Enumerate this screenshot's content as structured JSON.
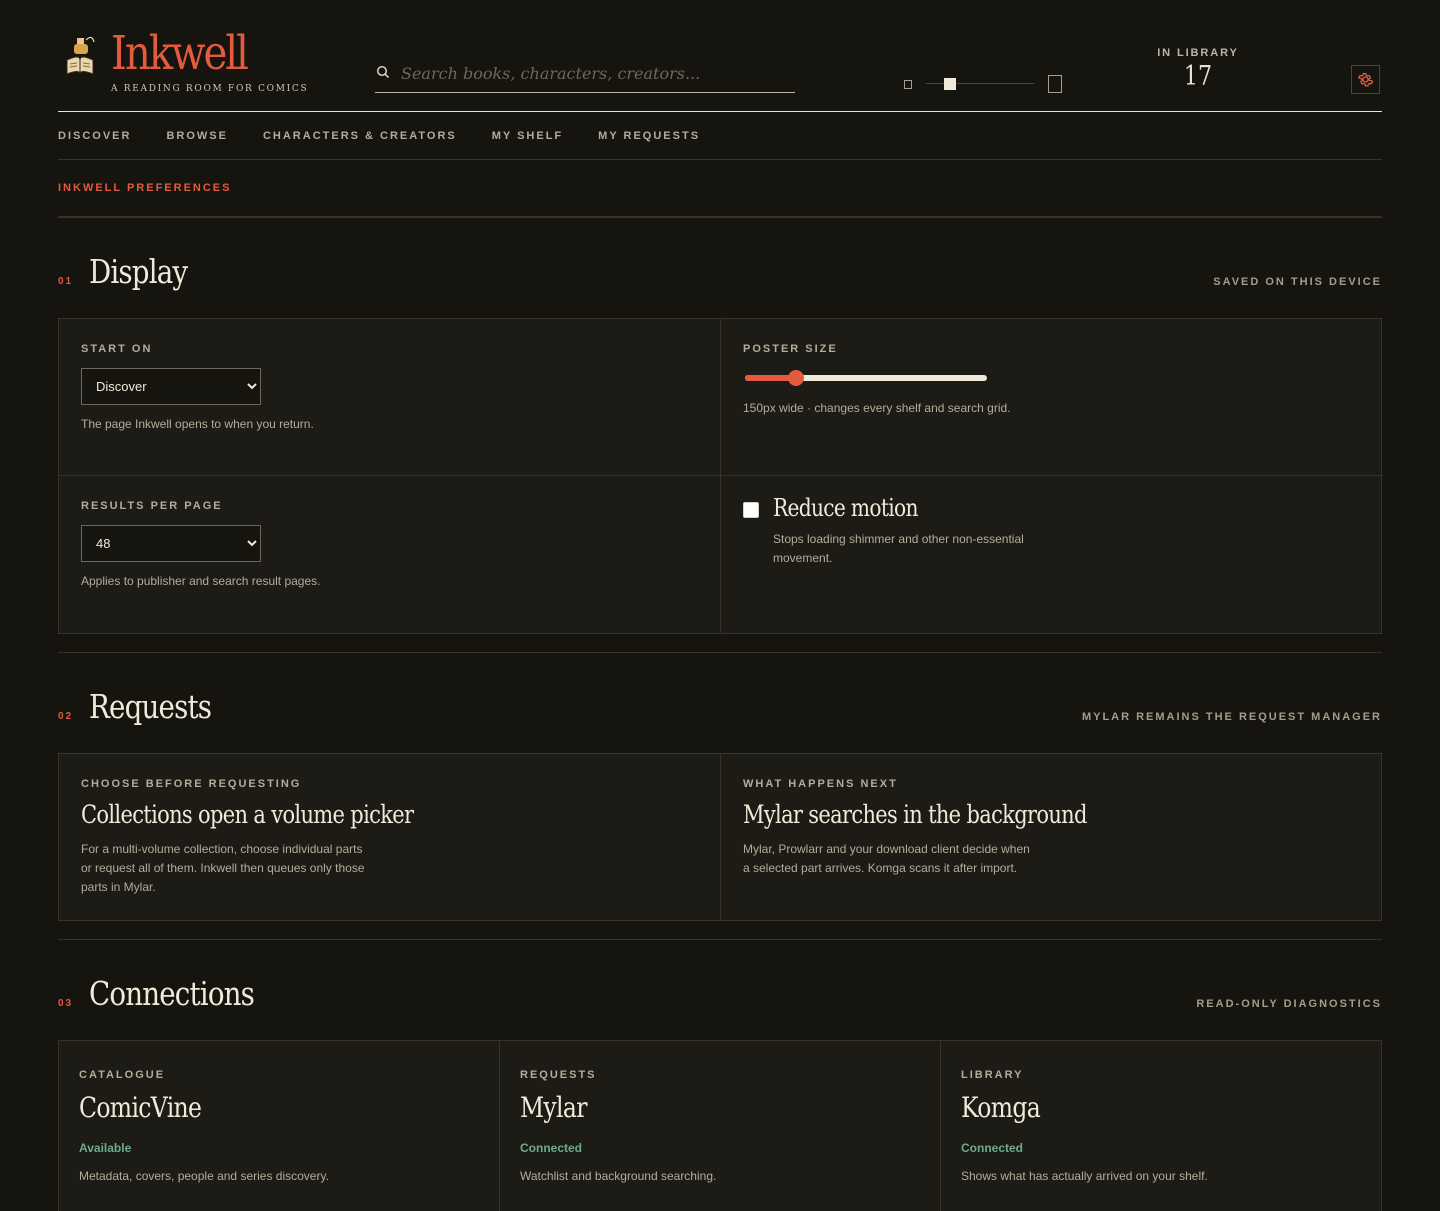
{
  "brand": {
    "name": "Inkwell",
    "tagline": "A READING ROOM FOR COMICS"
  },
  "search": {
    "placeholder": "Search books, characters, creators..."
  },
  "library": {
    "label": "IN LIBRARY",
    "count": "17"
  },
  "icons": {
    "logo": "inkwell-reading-icon",
    "search": "search-icon",
    "settings": "gear-icon"
  },
  "colors": {
    "accent": "#e35a3f",
    "background": "#16140f",
    "status_ok": "#6dab8c"
  },
  "nav": [
    "DISCOVER",
    "BROWSE",
    "CHARACTERS & CREATORS",
    "MY SHELF",
    "MY REQUESTS"
  ],
  "breadcrumb": "INKWELL PREFERENCES",
  "display": {
    "num": "01",
    "title": "Display",
    "note": "SAVED ON THIS DEVICE",
    "start_on": {
      "label": "START ON",
      "value": "Discover",
      "help": "The page Inkwell opens to when you return."
    },
    "poster_size": {
      "label": "POSTER SIZE",
      "fraction": 0.21,
      "help": "150px wide · changes every shelf and search grid."
    },
    "results": {
      "label": "RESULTS PER PAGE",
      "value": "48",
      "help": "Applies to publisher and search result pages."
    },
    "reduce_motion": {
      "label": "Reduce motion",
      "checked": false,
      "help": "Stops loading shimmer and other non-essential movement."
    }
  },
  "requests": {
    "num": "02",
    "title": "Requests",
    "note": "MYLAR REMAINS THE REQUEST MANAGER",
    "cards": [
      {
        "eyebrow": "CHOOSE BEFORE REQUESTING",
        "title": "Collections open a volume picker",
        "body": "For a multi-volume collection, choose individual parts or request all of them. Inkwell then queues only those parts in Mylar."
      },
      {
        "eyebrow": "WHAT HAPPENS NEXT",
        "title": "Mylar searches in the background",
        "body": "Mylar, Prowlarr and your download client decide when a selected part arrives. Komga scans it after import."
      }
    ]
  },
  "connections": {
    "num": "03",
    "title": "Connections",
    "note": "READ-ONLY DIAGNOSTICS",
    "cards": [
      {
        "eyebrow": "CATALOGUE",
        "title": "ComicVine",
        "status": "Available",
        "body": "Metadata, covers, people and series discovery."
      },
      {
        "eyebrow": "REQUESTS",
        "title": "Mylar",
        "status": "Connected",
        "body": "Watchlist and background searching."
      },
      {
        "eyebrow": "LIBRARY",
        "title": "Komga",
        "status": "Connected",
        "body": "Shows what has actually arrived on your shelf."
      }
    ]
  }
}
